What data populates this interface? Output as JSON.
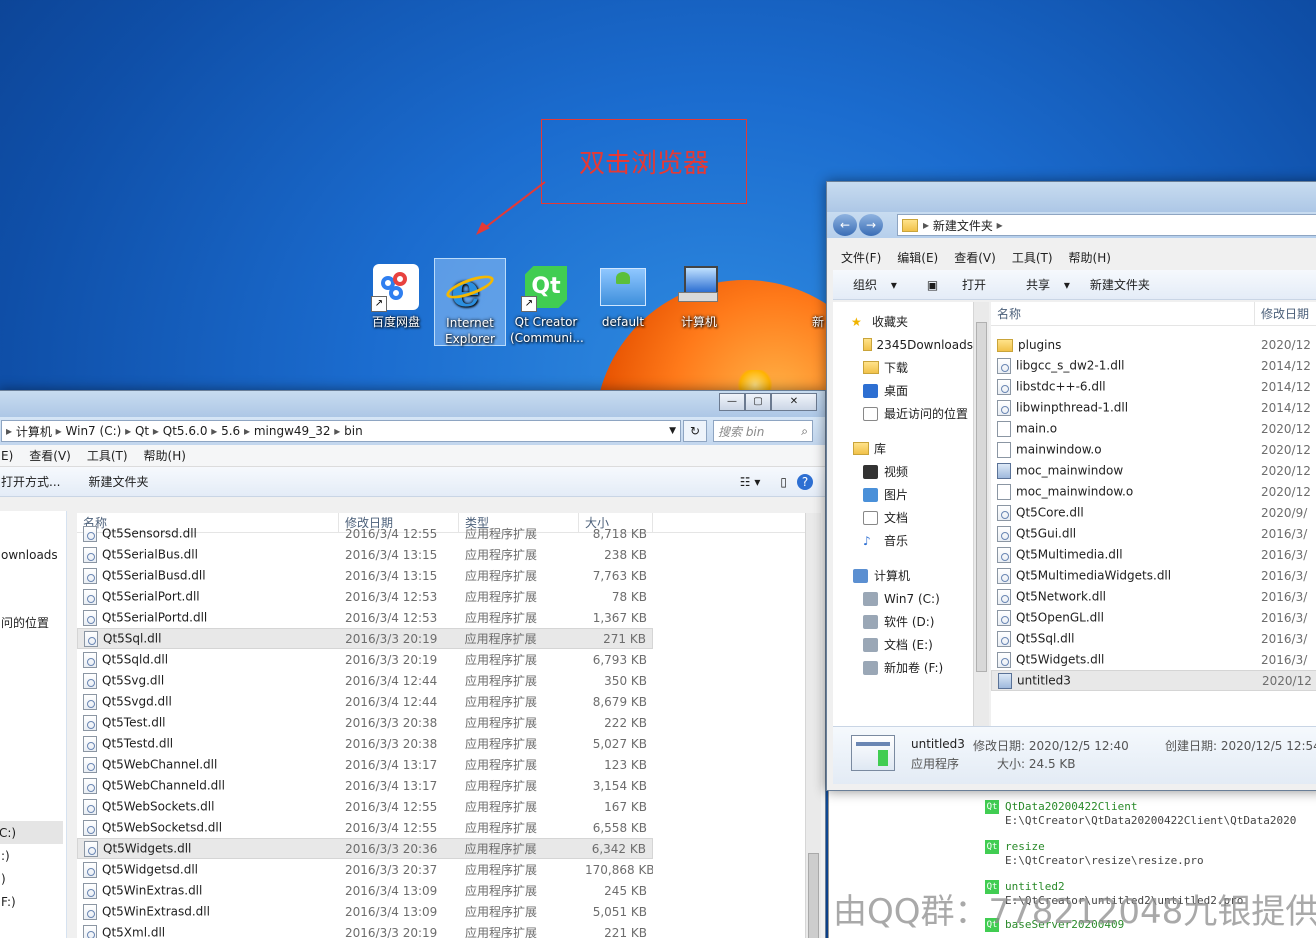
{
  "annotation": {
    "text": "双击浏览器"
  },
  "desktop_icons": [
    {
      "label": "百度网盘",
      "icon": "baidu-netdisk-icon"
    },
    {
      "label": "Internet\nExplorer",
      "line1": "Internet",
      "line2": "Explorer",
      "icon": "internet-explorer-icon"
    },
    {
      "label": "Qt Creator (Communi...",
      "line1": "Qt Creator",
      "line2": "(Communi...",
      "icon": "qt-creator-icon"
    },
    {
      "label": "default",
      "icon": "default-app-icon"
    },
    {
      "label": "计算机",
      "icon": "computer-icon"
    },
    {
      "label": "新",
      "icon": "partial-icon"
    }
  ],
  "left_window": {
    "breadcrumb": [
      "计算机",
      "Win7 (C:)",
      "Qt",
      "Qt5.6.0",
      "5.6",
      "mingw49_32",
      "bin"
    ],
    "search_placeholder": "搜索 bin",
    "menu": [
      "E)",
      "查看(V)",
      "工具(T)",
      "帮助(H)"
    ],
    "toolbar": [
      "打开方式...",
      "新建文件夹"
    ],
    "nav_partial": [
      "ownloads",
      "问的位置",
      "C:)",
      ":)",
      ")",
      "F:)"
    ],
    "columns": [
      "名称",
      "修改日期",
      "类型",
      "大小"
    ],
    "rows": [
      {
        "name": "Qt5Sensorsd.dll",
        "date": "2016/3/4 12:55",
        "type": "应用程序扩展",
        "size": "8,718 KB"
      },
      {
        "name": "Qt5SerialBus.dll",
        "date": "2016/3/4 13:15",
        "type": "应用程序扩展",
        "size": "238 KB"
      },
      {
        "name": "Qt5SerialBusd.dll",
        "date": "2016/3/4 13:15",
        "type": "应用程序扩展",
        "size": "7,763 KB"
      },
      {
        "name": "Qt5SerialPort.dll",
        "date": "2016/3/4 12:53",
        "type": "应用程序扩展",
        "size": "78 KB"
      },
      {
        "name": "Qt5SerialPortd.dll",
        "date": "2016/3/4 12:53",
        "type": "应用程序扩展",
        "size": "1,367 KB"
      },
      {
        "name": "Qt5Sql.dll",
        "date": "2016/3/3 20:19",
        "type": "应用程序扩展",
        "size": "271 KB",
        "highlight": true
      },
      {
        "name": "Qt5Sqld.dll",
        "date": "2016/3/3 20:19",
        "type": "应用程序扩展",
        "size": "6,793 KB"
      },
      {
        "name": "Qt5Svg.dll",
        "date": "2016/3/4 12:44",
        "type": "应用程序扩展",
        "size": "350 KB"
      },
      {
        "name": "Qt5Svgd.dll",
        "date": "2016/3/4 12:44",
        "type": "应用程序扩展",
        "size": "8,679 KB"
      },
      {
        "name": "Qt5Test.dll",
        "date": "2016/3/3 20:38",
        "type": "应用程序扩展",
        "size": "222 KB"
      },
      {
        "name": "Qt5Testd.dll",
        "date": "2016/3/3 20:38",
        "type": "应用程序扩展",
        "size": "5,027 KB"
      },
      {
        "name": "Qt5WebChannel.dll",
        "date": "2016/3/4 13:17",
        "type": "应用程序扩展",
        "size": "123 KB"
      },
      {
        "name": "Qt5WebChanneld.dll",
        "date": "2016/3/4 13:17",
        "type": "应用程序扩展",
        "size": "3,154 KB"
      },
      {
        "name": "Qt5WebSockets.dll",
        "date": "2016/3/4 12:55",
        "type": "应用程序扩展",
        "size": "167 KB"
      },
      {
        "name": "Qt5WebSocketsd.dll",
        "date": "2016/3/4 12:55",
        "type": "应用程序扩展",
        "size": "6,558 KB"
      },
      {
        "name": "Qt5Widgets.dll",
        "date": "2016/3/3 20:36",
        "type": "应用程序扩展",
        "size": "6,342 KB",
        "highlight": true
      },
      {
        "name": "Qt5Widgetsd.dll",
        "date": "2016/3/3 20:37",
        "type": "应用程序扩展",
        "size": "170,868 KB"
      },
      {
        "name": "Qt5WinExtras.dll",
        "date": "2016/3/4 13:09",
        "type": "应用程序扩展",
        "size": "245 KB"
      },
      {
        "name": "Qt5WinExtrasd.dll",
        "date": "2016/3/4 13:09",
        "type": "应用程序扩展",
        "size": "5,051 KB"
      },
      {
        "name": "Qt5Xml.dll",
        "date": "2016/3/3 20:19",
        "type": "应用程序扩展",
        "size": "221 KB"
      }
    ]
  },
  "right_window": {
    "breadcrumb": "新建文件夹",
    "menu": [
      "文件(F)",
      "编辑(E)",
      "查看(V)",
      "工具(T)",
      "帮助(H)"
    ],
    "toolbar": {
      "organize": "组织",
      "open": "打开",
      "share": "共享",
      "new_folder": "新建文件夹"
    },
    "nav": {
      "favorites": "收藏夹",
      "fav_items": [
        "2345Downloads",
        "下载",
        "桌面",
        "最近访问的位置"
      ],
      "libraries": "库",
      "lib_items": [
        "视频",
        "图片",
        "文档",
        "音乐"
      ],
      "computer": "计算机",
      "drives": [
        "Win7 (C:)",
        "软件 (D:)",
        "文档 (E:)",
        "新加卷 (F:)"
      ]
    },
    "columns": [
      "名称",
      "修改日期"
    ],
    "rows": [
      {
        "name": "plugins",
        "date": "2020/12",
        "kind": "folder"
      },
      {
        "name": "libgcc_s_dw2-1.dll",
        "date": "2014/12",
        "kind": "dll"
      },
      {
        "name": "libstdc++-6.dll",
        "date": "2014/12",
        "kind": "dll"
      },
      {
        "name": "libwinpthread-1.dll",
        "date": "2014/12",
        "kind": "dll"
      },
      {
        "name": "main.o",
        "date": "2020/12",
        "kind": "blank"
      },
      {
        "name": "mainwindow.o",
        "date": "2020/12",
        "kind": "blank"
      },
      {
        "name": "moc_mainwindow",
        "date": "2020/12",
        "kind": "exe"
      },
      {
        "name": "moc_mainwindow.o",
        "date": "2020/12",
        "kind": "blank"
      },
      {
        "name": "Qt5Core.dll",
        "date": "2020/9/",
        "kind": "dll"
      },
      {
        "name": "Qt5Gui.dll",
        "date": "2016/3/",
        "kind": "dll"
      },
      {
        "name": "Qt5Multimedia.dll",
        "date": "2016/3/",
        "kind": "dll"
      },
      {
        "name": "Qt5MultimediaWidgets.dll",
        "date": "2016/3/",
        "kind": "dll"
      },
      {
        "name": "Qt5Network.dll",
        "date": "2016/3/",
        "kind": "dll"
      },
      {
        "name": "Qt5OpenGL.dll",
        "date": "2016/3/",
        "kind": "dll"
      },
      {
        "name": "Qt5Sql.dll",
        "date": "2016/3/",
        "kind": "dll"
      },
      {
        "name": "Qt5Widgets.dll",
        "date": "2016/3/",
        "kind": "dll"
      },
      {
        "name": "untitled3",
        "date": "2020/12",
        "kind": "exe",
        "highlight": true
      }
    ],
    "details": {
      "name": "untitled3",
      "modified_label": "修改日期: 2020/12/5 12:40",
      "created_label": "创建日期: 2020/12/5 12:54",
      "type": "应用程序",
      "size_label": "大小: 24.5 KB"
    }
  },
  "qt_projects": [
    {
      "name": "QtData20200422Client",
      "path": "E:\\QtCreator\\QtData20200422Client\\QtData2020"
    },
    {
      "name": "resize",
      "path": "E:\\QtCreator\\resize\\resize.pro"
    },
    {
      "name": "untitled2",
      "path": "E:\\QtCreator\\untitled2\\untitled2.pro"
    },
    {
      "name": "baseServer20200409",
      "path": ""
    }
  ],
  "watermark": "由QQ群：778212048九银提供",
  "colors": {
    "desktop": "#1b6ccf",
    "annotation": "#e53935",
    "qt_green": "#41cd52"
  }
}
